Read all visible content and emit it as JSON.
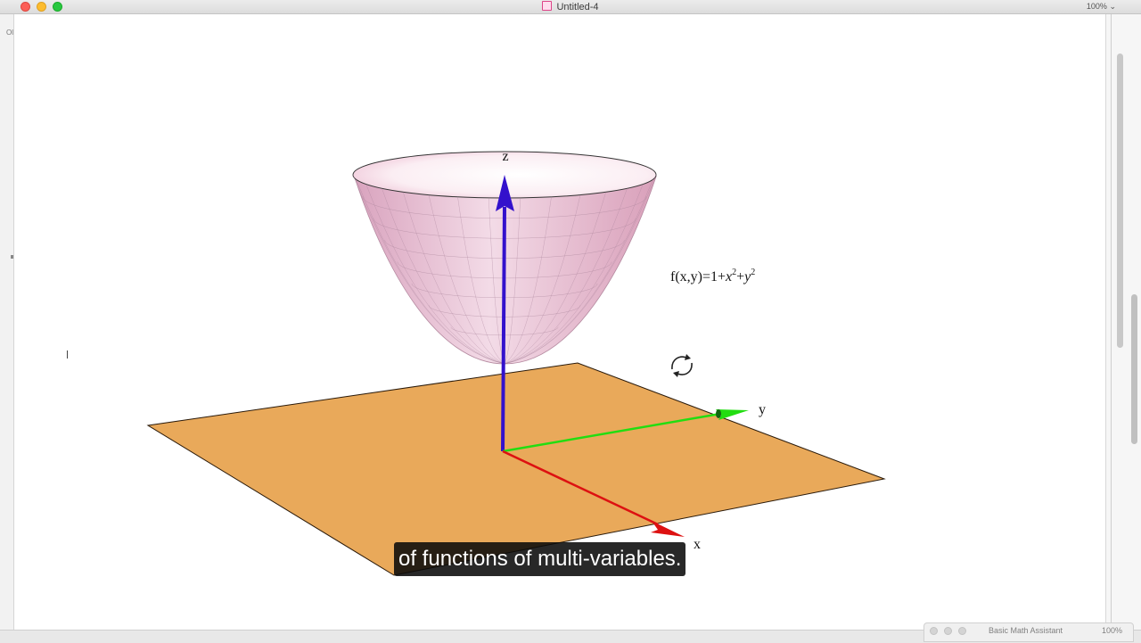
{
  "window": {
    "title": "Untitled-4",
    "zoom": "100%",
    "left_fragment": "Ol"
  },
  "plot": {
    "function_label": {
      "prefix": "f(x,y)=1+",
      "var1": "x",
      "exp1": "2",
      "plus": "+",
      "var2": "y",
      "exp2": "2"
    },
    "axes": {
      "x": "x",
      "y": "y",
      "z": "z"
    },
    "colors": {
      "plane": "#e9a95a",
      "surface": "#f2ccdb",
      "x_axis": "#dd1111",
      "y_axis": "#22dd11",
      "z_axis": "#3311cc"
    }
  },
  "caption": "of functions of multi-variables.",
  "palette": {
    "title": "Basic Math Assistant",
    "zoom": "100%"
  }
}
